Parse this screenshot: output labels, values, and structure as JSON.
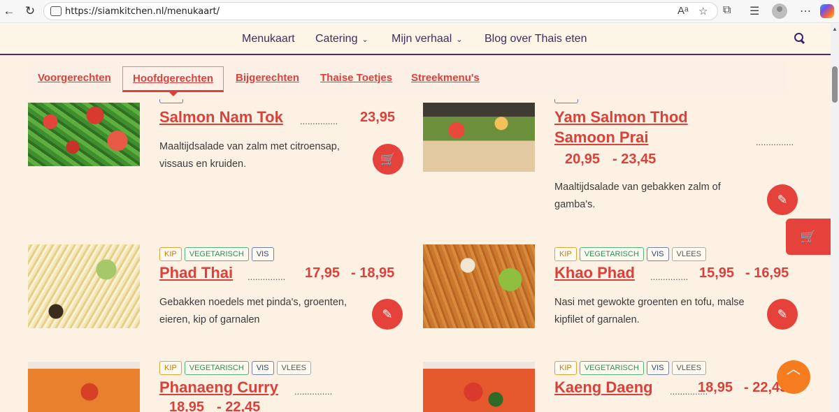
{
  "browser": {
    "url": "https://siamkitchen.nl/menukaart/",
    "back_glyph": "←",
    "reload_glyph": "↻"
  },
  "site_nav": {
    "items": [
      {
        "label": "Menukaart",
        "has_dropdown": false
      },
      {
        "label": "Catering",
        "has_dropdown": true
      },
      {
        "label": "Mijn verhaal",
        "has_dropdown": true
      },
      {
        "label": "Blog over Thais eten",
        "has_dropdown": false
      }
    ]
  },
  "tabs": [
    {
      "label": "Voorgerechten",
      "active": false
    },
    {
      "label": "Hoofdgerechten",
      "active": true
    },
    {
      "label": "Bijgerechten",
      "active": false
    },
    {
      "label": "Thaise Toetjes",
      "active": false
    },
    {
      "label": "Streekmenu's",
      "active": false
    }
  ],
  "badge_labels": {
    "kip": "KIP",
    "veg": "VEGETARISCH",
    "vis": "VIS",
    "vlees": "VLEES"
  },
  "dishes": [
    {
      "name": "Salmon Nam Tok",
      "price": "23,95",
      "desc_1": "Maaltijdsalade van zalm met citroensap,",
      "desc_2": "vissaus en kruiden."
    },
    {
      "name_1": "Yam Salmon Thod",
      "name_2": "Samoon Prai",
      "price_low": "20,95",
      "price_high": "- 23,45",
      "desc_1": "Maaltijdsalade van gebakken zalm of",
      "desc_2": "gamba's."
    },
    {
      "name": "Phad Thai",
      "price_low": "17,95",
      "price_high": "- 18,95",
      "desc_1": "Gebakken noedels met pinda's, groenten,",
      "desc_2": "eieren, kip of garnalen"
    },
    {
      "name": "Khao Phad",
      "price_low": "15,95",
      "price_high": "- 16,95",
      "desc_1": "Nasi met gewokte groenten en tofu, malse",
      "desc_2": "kipfilet of garnalen."
    },
    {
      "name": "Phanaeng Curry",
      "price_low": "18,95",
      "price_high": "- 22,45"
    },
    {
      "name": "Kaeng Daeng",
      "price_low": "18,95",
      "price_high": "- 22,45"
    }
  ],
  "dots": "...............",
  "colors": {
    "accent": "#d9423b",
    "nav_text": "#3f2b66",
    "scroll_top": "#f57c1f"
  }
}
